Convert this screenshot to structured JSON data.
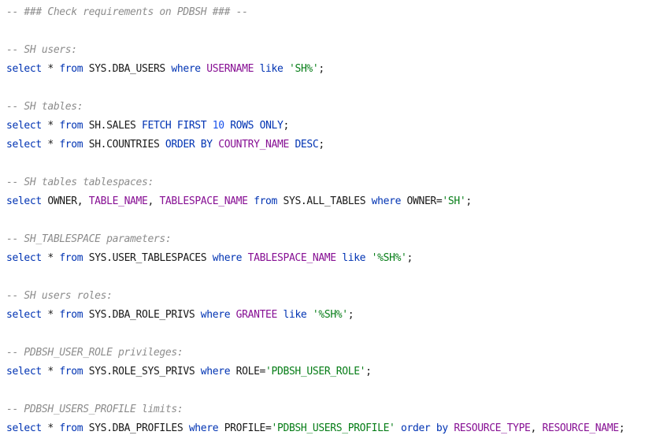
{
  "editor": {
    "lines": [
      [
        {
          "t": "-- ### Check requirements on PDBSH ### --",
          "c": "comment"
        }
      ],
      [],
      [
        {
          "t": "-- SH users:",
          "c": "comment"
        }
      ],
      [
        {
          "t": "select",
          "c": "keyword"
        },
        {
          "t": " * ",
          "c": "plain"
        },
        {
          "t": "from",
          "c": "keyword"
        },
        {
          "t": " SYS.DBA_USERS ",
          "c": "plain"
        },
        {
          "t": "where",
          "c": "keyword"
        },
        {
          "t": " ",
          "c": "plain"
        },
        {
          "t": "USERNAME",
          "c": "column"
        },
        {
          "t": " ",
          "c": "plain"
        },
        {
          "t": "like",
          "c": "keyword"
        },
        {
          "t": " ",
          "c": "plain"
        },
        {
          "t": "'SH%'",
          "c": "string"
        },
        {
          "t": ";",
          "c": "plain"
        }
      ],
      [],
      [
        {
          "t": "-- SH tables:",
          "c": "comment"
        }
      ],
      [
        {
          "t": "select",
          "c": "keyword"
        },
        {
          "t": " * ",
          "c": "plain"
        },
        {
          "t": "from",
          "c": "keyword"
        },
        {
          "t": " SH.SALES ",
          "c": "plain"
        },
        {
          "t": "FETCH FIRST",
          "c": "keyword"
        },
        {
          "t": " ",
          "c": "plain"
        },
        {
          "t": "10",
          "c": "number"
        },
        {
          "t": " ",
          "c": "plain"
        },
        {
          "t": "ROWS ONLY",
          "c": "keyword"
        },
        {
          "t": ";",
          "c": "plain"
        }
      ],
      [
        {
          "t": "select",
          "c": "keyword"
        },
        {
          "t": " * ",
          "c": "plain"
        },
        {
          "t": "from",
          "c": "keyword"
        },
        {
          "t": " SH.COUNTRIES ",
          "c": "plain"
        },
        {
          "t": "ORDER BY",
          "c": "keyword"
        },
        {
          "t": " ",
          "c": "plain"
        },
        {
          "t": "COUNTRY_NAME",
          "c": "column"
        },
        {
          "t": " ",
          "c": "plain"
        },
        {
          "t": "DESC",
          "c": "keyword"
        },
        {
          "t": ";",
          "c": "plain"
        }
      ],
      [],
      [
        {
          "t": "-- SH tables tablespaces:",
          "c": "comment"
        }
      ],
      [
        {
          "t": "select",
          "c": "keyword"
        },
        {
          "t": " OWNER, ",
          "c": "plain"
        },
        {
          "t": "TABLE_NAME",
          "c": "column"
        },
        {
          "t": ", ",
          "c": "plain"
        },
        {
          "t": "TABLESPACE_NAME",
          "c": "column"
        },
        {
          "t": " ",
          "c": "plain"
        },
        {
          "t": "from",
          "c": "keyword"
        },
        {
          "t": " SYS.ALL_TABLES ",
          "c": "plain"
        },
        {
          "t": "where",
          "c": "keyword"
        },
        {
          "t": " OWNER=",
          "c": "plain"
        },
        {
          "t": "'SH'",
          "c": "string"
        },
        {
          "t": ";",
          "c": "plain"
        }
      ],
      [],
      [
        {
          "t": "-- SH_TABLESPACE parameters:",
          "c": "comment"
        }
      ],
      [
        {
          "t": "select",
          "c": "keyword"
        },
        {
          "t": " * ",
          "c": "plain"
        },
        {
          "t": "from",
          "c": "keyword"
        },
        {
          "t": " SYS.USER_TABLESPACES ",
          "c": "plain"
        },
        {
          "t": "where",
          "c": "keyword"
        },
        {
          "t": " ",
          "c": "plain"
        },
        {
          "t": "TABLESPACE_NAME",
          "c": "column"
        },
        {
          "t": " ",
          "c": "plain"
        },
        {
          "t": "like",
          "c": "keyword"
        },
        {
          "t": " ",
          "c": "plain"
        },
        {
          "t": "'%SH%'",
          "c": "string"
        },
        {
          "t": ";",
          "c": "plain"
        }
      ],
      [],
      [
        {
          "t": "-- SH users roles:",
          "c": "comment"
        }
      ],
      [
        {
          "t": "select",
          "c": "keyword"
        },
        {
          "t": " * ",
          "c": "plain"
        },
        {
          "t": "from",
          "c": "keyword"
        },
        {
          "t": " SYS.DBA_ROLE_PRIVS ",
          "c": "plain"
        },
        {
          "t": "where",
          "c": "keyword"
        },
        {
          "t": " ",
          "c": "plain"
        },
        {
          "t": "GRANTEE",
          "c": "column"
        },
        {
          "t": " ",
          "c": "plain"
        },
        {
          "t": "like",
          "c": "keyword"
        },
        {
          "t": " ",
          "c": "plain"
        },
        {
          "t": "'%SH%'",
          "c": "string"
        },
        {
          "t": ";",
          "c": "plain"
        }
      ],
      [],
      [
        {
          "t": "-- PDBSH_USER_ROLE privileges:",
          "c": "comment"
        }
      ],
      [
        {
          "t": "select",
          "c": "keyword"
        },
        {
          "t": " * ",
          "c": "plain"
        },
        {
          "t": "from",
          "c": "keyword"
        },
        {
          "t": " SYS.ROLE_SYS_PRIVS ",
          "c": "plain"
        },
        {
          "t": "where",
          "c": "keyword"
        },
        {
          "t": " ROLE=",
          "c": "plain"
        },
        {
          "t": "'PDBSH_USER_ROLE'",
          "c": "string"
        },
        {
          "t": ";",
          "c": "plain"
        }
      ],
      [],
      [
        {
          "t": "-- PDBSH_USERS_PROFILE limits:",
          "c": "comment"
        }
      ],
      [
        {
          "t": "select",
          "c": "keyword"
        },
        {
          "t": " * ",
          "c": "plain"
        },
        {
          "t": "from",
          "c": "keyword"
        },
        {
          "t": " SYS.DBA_PROFILES ",
          "c": "plain"
        },
        {
          "t": "where",
          "c": "keyword"
        },
        {
          "t": " PROFILE=",
          "c": "plain"
        },
        {
          "t": "'PDBSH_USERS_PROFILE'",
          "c": "string"
        },
        {
          "t": " ",
          "c": "plain"
        },
        {
          "t": "order by",
          "c": "keyword"
        },
        {
          "t": " ",
          "c": "plain"
        },
        {
          "t": "RESOURCE_TYPE",
          "c": "column"
        },
        {
          "t": ", ",
          "c": "plain"
        },
        {
          "t": "RESOURCE_NAME",
          "c": "column"
        },
        {
          "t": ";",
          "c": "plain"
        }
      ]
    ]
  }
}
